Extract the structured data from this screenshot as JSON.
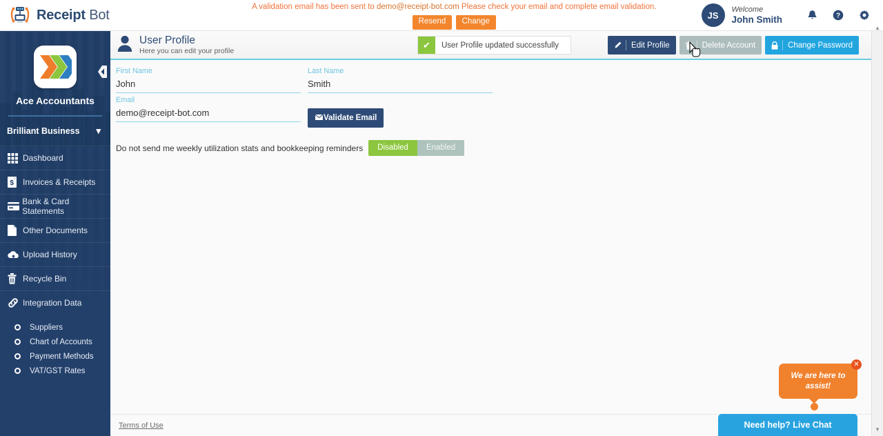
{
  "brand": {
    "name_bold": "Receipt",
    "name_light": " Bot",
    "logo_icon": "receipt-bot-logo-icon"
  },
  "header": {
    "validation_prefix": "A validation email has been sent to ",
    "validation_email": "demo@receipt-bot.com",
    "validation_suffix": " Please check your email and complete email validation.",
    "resend_label": "Resend",
    "change_label": "Change",
    "avatar_initials": "JS",
    "welcome_label": "Welcome",
    "user_name": "John Smith",
    "bell_icon": "bell-icon",
    "help_icon": "help-circle-icon",
    "settings_icon": "gear-icon"
  },
  "sidebar": {
    "company_name": "Ace Accountants",
    "business_name": "Brilliant Business",
    "business_chevron": "chevron-down-icon",
    "collapse_icon": "collapse-sidebar-icon",
    "items": [
      {
        "label": "Dashboard",
        "icon": "grid-dashboard-icon"
      },
      {
        "label": "Invoices & Receipts",
        "icon": "invoice-document-icon"
      },
      {
        "label": "Bank & Card Statements",
        "icon": "credit-card-icon"
      },
      {
        "label": "Other Documents",
        "icon": "file-document-icon"
      },
      {
        "label": "Upload History",
        "icon": "cloud-upload-icon"
      },
      {
        "label": "Recycle Bin",
        "icon": "trash-bin-icon"
      },
      {
        "label": "Integration Data",
        "icon": "link-chain-icon"
      }
    ],
    "subitems": [
      {
        "label": "Suppliers"
      },
      {
        "label": "Chart of Accounts"
      },
      {
        "label": "Payment Methods"
      },
      {
        "label": "VAT/GST Rates"
      }
    ]
  },
  "page": {
    "title": "User Profile",
    "subtitle": "Here you can edit your profile",
    "title_icon": "user-avatar-icon",
    "toast": {
      "text": "User Profile updated successfully",
      "icon": "check-icon"
    },
    "actions": [
      {
        "label": "Edit Profile",
        "icon": "pencil-icon",
        "style": "dark"
      },
      {
        "label": "Delete Account",
        "icon": "trash-icon",
        "style": "gray"
      },
      {
        "label": "Change Password",
        "icon": "lock-icon",
        "style": "blue"
      }
    ]
  },
  "form": {
    "first_name": {
      "label": "First Name",
      "value": "John",
      "placeholder": "First Name"
    },
    "last_name": {
      "label": "Last Name",
      "value": "Smith",
      "placeholder": "Last Name"
    },
    "email": {
      "label": "Email",
      "value": "demo@receipt-bot.com",
      "placeholder": "Email"
    },
    "validate_button": {
      "label": "Validate Email",
      "icon": "envelope-icon"
    },
    "toggle": {
      "label": "Do not send me weekly utilization stats and bookkeeping reminders",
      "disabled_label": "Disabled",
      "enabled_label": "Enabled",
      "selected": "Disabled"
    }
  },
  "footer": {
    "terms_label": "Terms of Use"
  },
  "chat": {
    "bubble_line1": "We are here to",
    "bubble_line2": "assist!",
    "close_icon": "close-icon",
    "bar_label": "Need help? Live Chat"
  },
  "colors": {
    "sidebar_navy": "#23406b",
    "accent_blue": "#22a5df",
    "accent_orange": "#f3862d",
    "accent_green": "#8cc63e",
    "underline_cyan": "#8ed4e6"
  }
}
